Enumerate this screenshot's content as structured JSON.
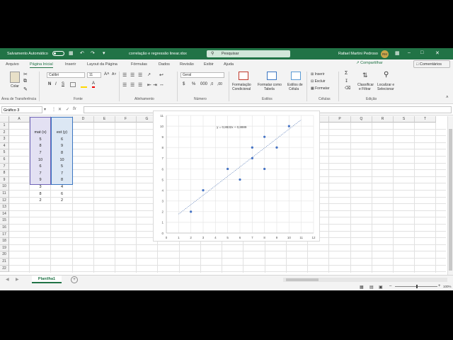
{
  "titlebar": {
    "autosave_label": "Salvamento Automático",
    "filename": "correlação e regressão linear.xlsx",
    "search_placeholder": "Pesquisar",
    "user_name": "Rafael Martini Pedroso",
    "user_initials": "RM"
  },
  "tabs": [
    "Arquivo",
    "Página Inicial",
    "Inserir",
    "Layout da Página",
    "Fórmulas",
    "Dados",
    "Revisão",
    "Exibir",
    "Ajuda"
  ],
  "share_label": "Compartilhar",
  "comments_label": "Comentários",
  "ribbon": {
    "paste_label": "Colar",
    "clipboard_group": "Área de Transferência",
    "font_name": "Calibri",
    "font_size": "11",
    "bold": "N",
    "italic": "I",
    "underline": "S",
    "font_group": "Fonte",
    "alignment_group": "Alinhamento",
    "number_format": "Geral",
    "number_group": "Número",
    "conditional_label_1": "Formatação",
    "conditional_label_2": "Condicional",
    "format_table_1": "Formatar como",
    "format_table_2": "Tabela",
    "cell_styles_1": "Estilos de",
    "cell_styles_2": "Célula",
    "styles_group": "Estilos",
    "insert_label": "Inserir",
    "delete_label": "Excluir",
    "format_label": "Formatar",
    "cells_group": "Células",
    "sort_1": "Classificar",
    "sort_2": "e Filtrar",
    "find_1": "Localizar e",
    "find_2": "Selecionar",
    "editing_group": "Edição"
  },
  "formula_bar": {
    "name_box": "Gráfico 3",
    "fx": "fx"
  },
  "columns": [
    "A",
    "B",
    "C",
    "D",
    "E",
    "F",
    "G",
    "H",
    "I",
    "J",
    "K",
    "L",
    "M",
    "N",
    "O",
    "P",
    "Q",
    "R",
    "S",
    "T"
  ],
  "rows": [
    "1",
    "2",
    "3",
    "4",
    "5",
    "6",
    "7",
    "8",
    "9",
    "10",
    "11",
    "12",
    "13",
    "14",
    "15",
    "16",
    "17",
    "18",
    "19",
    "20",
    "21",
    "22"
  ],
  "table": {
    "header_x": "mat (x)",
    "header_y": "est (y)",
    "x_values": [
      "5",
      "8",
      "7",
      "10",
      "6",
      "7",
      "9",
      "3",
      "8",
      "2"
    ],
    "y_values": [
      "6",
      "9",
      "8",
      "10",
      "5",
      "7",
      "8",
      "4",
      "6",
      "2"
    ]
  },
  "chart_data": {
    "type": "scatter",
    "x": [
      5,
      8,
      7,
      10,
      6,
      7,
      9,
      3,
      8,
      2
    ],
    "y": [
      6,
      9,
      8,
      10,
      5,
      7,
      8,
      4,
      6,
      2
    ],
    "xlim": [
      0,
      12
    ],
    "ylim": [
      0,
      11
    ],
    "xticks": [
      "0",
      "1",
      "2",
      "3",
      "4",
      "5",
      "6",
      "7",
      "8",
      "9",
      "10",
      "11",
      "12"
    ],
    "yticks": [
      "0",
      "1",
      "2",
      "3",
      "4",
      "5",
      "6",
      "7",
      "8",
      "9",
      "10",
      "11"
    ],
    "trendline": {
      "type": "linear",
      "slope": 0.8832,
      "intercept": 0.8889,
      "x_range": [
        1,
        11
      ]
    },
    "equation_label": "y = 0,8832x + 0,8889",
    "grid": true,
    "marker_color": "#4472C4"
  },
  "sheet_tab": "Planilha1",
  "add_sheet": "+",
  "zoom": "100%",
  "colors": {
    "excel_green": "#217346",
    "marker": "#4472C4"
  }
}
